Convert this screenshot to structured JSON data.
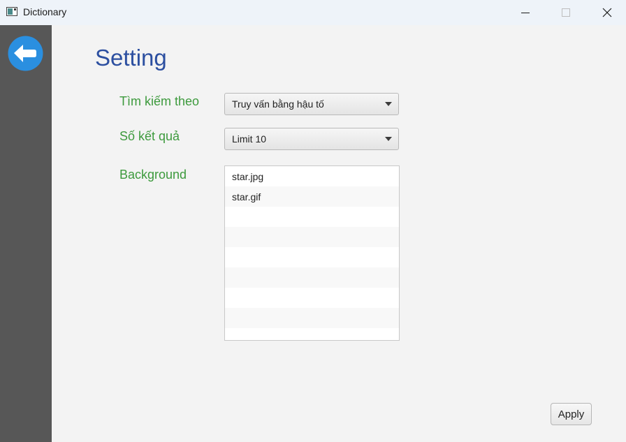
{
  "window": {
    "title": "Dictionary",
    "controls": [
      "minimize",
      "maximize",
      "close"
    ]
  },
  "sidebar": {
    "back_icon": "arrow-left-circle-icon",
    "back_color": "#2a8fe0"
  },
  "page": {
    "title": "Setting"
  },
  "settings": {
    "search_by_label": "Tìm kiếm theo",
    "search_by_value": "Truy vấn bằng hậu tố",
    "result_count_label": "Số kết quả",
    "result_count_value": "Limit 10",
    "background_label": "Background",
    "background_items": [
      "star.jpg",
      "star.gif",
      "",
      "",
      "",
      "",
      "",
      "",
      ""
    ]
  },
  "actions": {
    "apply_label": "Apply"
  },
  "colors": {
    "title": "#2c4fa0",
    "label": "#3d9a3d",
    "sidebar": "#575757"
  }
}
